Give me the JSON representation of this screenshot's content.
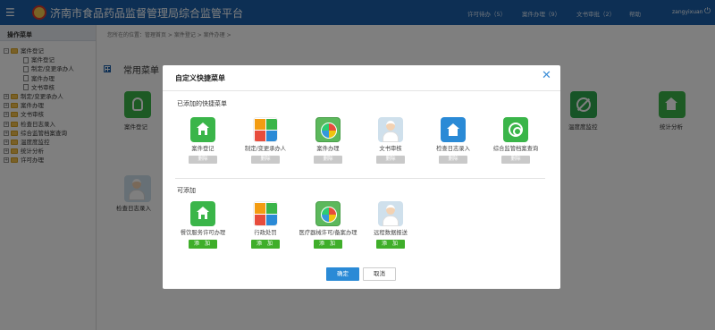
{
  "app": {
    "title": "济南市食品药品监督管理局综合监管平台",
    "menu_icon": "hamburger-icon",
    "logo_icon": "emblem-logo"
  },
  "topnav": {
    "items": [
      {
        "label": "许可待办（5）"
      },
      {
        "label": "案件办理（9）"
      },
      {
        "label": "文书审批（2）"
      },
      {
        "label": "帮助"
      }
    ],
    "user": "zangyixuan",
    "power_icon": "power-icon"
  },
  "sidebar": {
    "header": "操作菜单",
    "tree": [
      {
        "label": "案件登记",
        "expanded": true,
        "children": [
          "案件登记",
          "制定/变更承办人",
          "案件办理",
          "文书审核"
        ]
      },
      {
        "label": "制定/变更承办人"
      },
      {
        "label": "案件办理"
      },
      {
        "label": "文书审核"
      },
      {
        "label": "检查日志录入"
      },
      {
        "label": "综合监管档案查询"
      },
      {
        "label": "温度度监控"
      },
      {
        "label": "统计分析"
      },
      {
        "label": "许可办理"
      }
    ]
  },
  "main": {
    "breadcrumb": "您所在的位置：管理首页 > 案件登记 > 案件办理 >",
    "section_title": "常用菜单",
    "background_tiles": [
      {
        "label": "案件登记"
      },
      {
        "label": "检查日志录入"
      },
      {
        "label": "温度度监控"
      },
      {
        "label": "统计分析"
      }
    ]
  },
  "modal": {
    "title": "自定义快捷菜单",
    "close_icon": "close-icon",
    "added_group": "已添加的快捷菜单",
    "available_group": "可添加",
    "added": [
      {
        "label": "案件登记",
        "button": "删除",
        "icon": "house-icon"
      },
      {
        "label": "制定/变更承办人",
        "button": "删除",
        "icon": "colorful-squares-icon"
      },
      {
        "label": "案件办理",
        "button": "删除",
        "icon": "ball-icon"
      },
      {
        "label": "文书审核",
        "button": "删除",
        "icon": "officer-icon"
      },
      {
        "label": "检查日志录入",
        "button": "删除",
        "icon": "checked-house-icon"
      },
      {
        "label": "综合监管档案查询",
        "button": "删除",
        "icon": "wifi-icon"
      }
    ],
    "available": [
      {
        "label": "餐饮服务许可办理",
        "button": "添 加",
        "icon": "house-icon"
      },
      {
        "label": "行政处罚",
        "button": "添 加",
        "icon": "colorful-squares-icon"
      },
      {
        "label": "医疗器械许可/备案办理",
        "button": "添 加",
        "icon": "ball-icon"
      },
      {
        "label": "远程数据报送",
        "button": "添 加",
        "icon": "officer-icon"
      }
    ],
    "ok": "确定",
    "cancel": "取消"
  },
  "colors": {
    "topbar": "#1b5fa8",
    "accent": "#2a8ad6",
    "add_button": "#3fae2a",
    "delete_button": "#c9c9c9"
  }
}
